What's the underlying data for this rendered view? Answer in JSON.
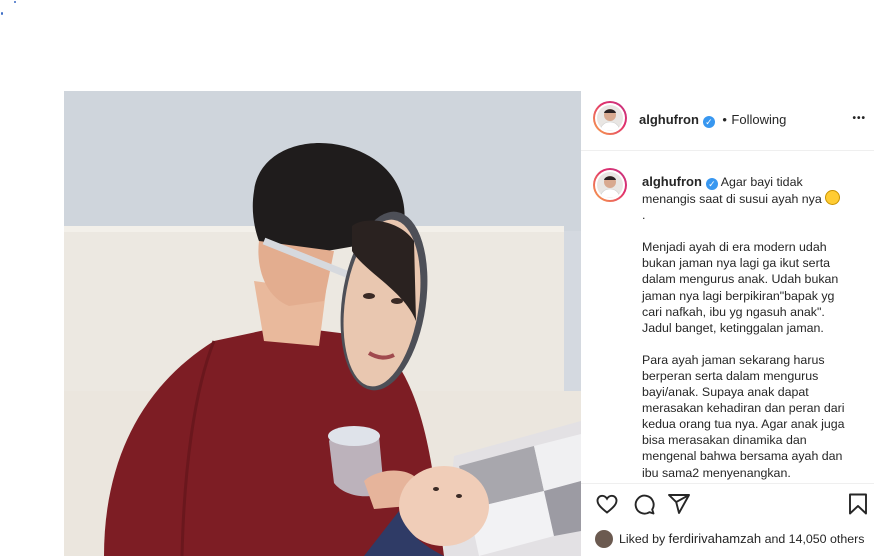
{
  "post": {
    "username": "alghufron",
    "verified_mark": "✓",
    "separator": "•",
    "follow_status": "Following",
    "more_label": "•••"
  },
  "caption": {
    "username": "alghufron",
    "first_line": "Agar bayi tidak menangis saat di susui ayah nya",
    "emoji": "grinning-face-sweat-emoji",
    "dot": ".",
    "paragraph_1": "Menjadi ayah di era modern udah bukan jaman nya lagi ga ikut serta dalam mengurus anak. Udah bukan jaman nya lagi berpikiran\"bapak yg cari nafkah, ibu yg ngasuh anak\". Jadul banget, ketinggalan jaman.",
    "paragraph_2": "Para ayah jaman sekarang harus berperan serta dalam mengurus bayi/anak. Supaya anak dapat merasakan kehadiran dan peran dari kedua orang tua nya. Agar anak juga bisa merasakan dinamika dan mengenal bahwa bersama ayah dan ibu sama2 menyenangkan."
  },
  "actions": {
    "icons": [
      "heart-icon",
      "comment-icon",
      "share-icon",
      "bookmark-icon"
    ],
    "liked_prefix": "Liked by",
    "liked_user": "ferdirivahamzah",
    "liked_suffix": "and 14,050 others"
  },
  "colors": {
    "verified": "#3897f0",
    "shirt": "#7d1d24",
    "avatar_ring": "#e1306c"
  }
}
